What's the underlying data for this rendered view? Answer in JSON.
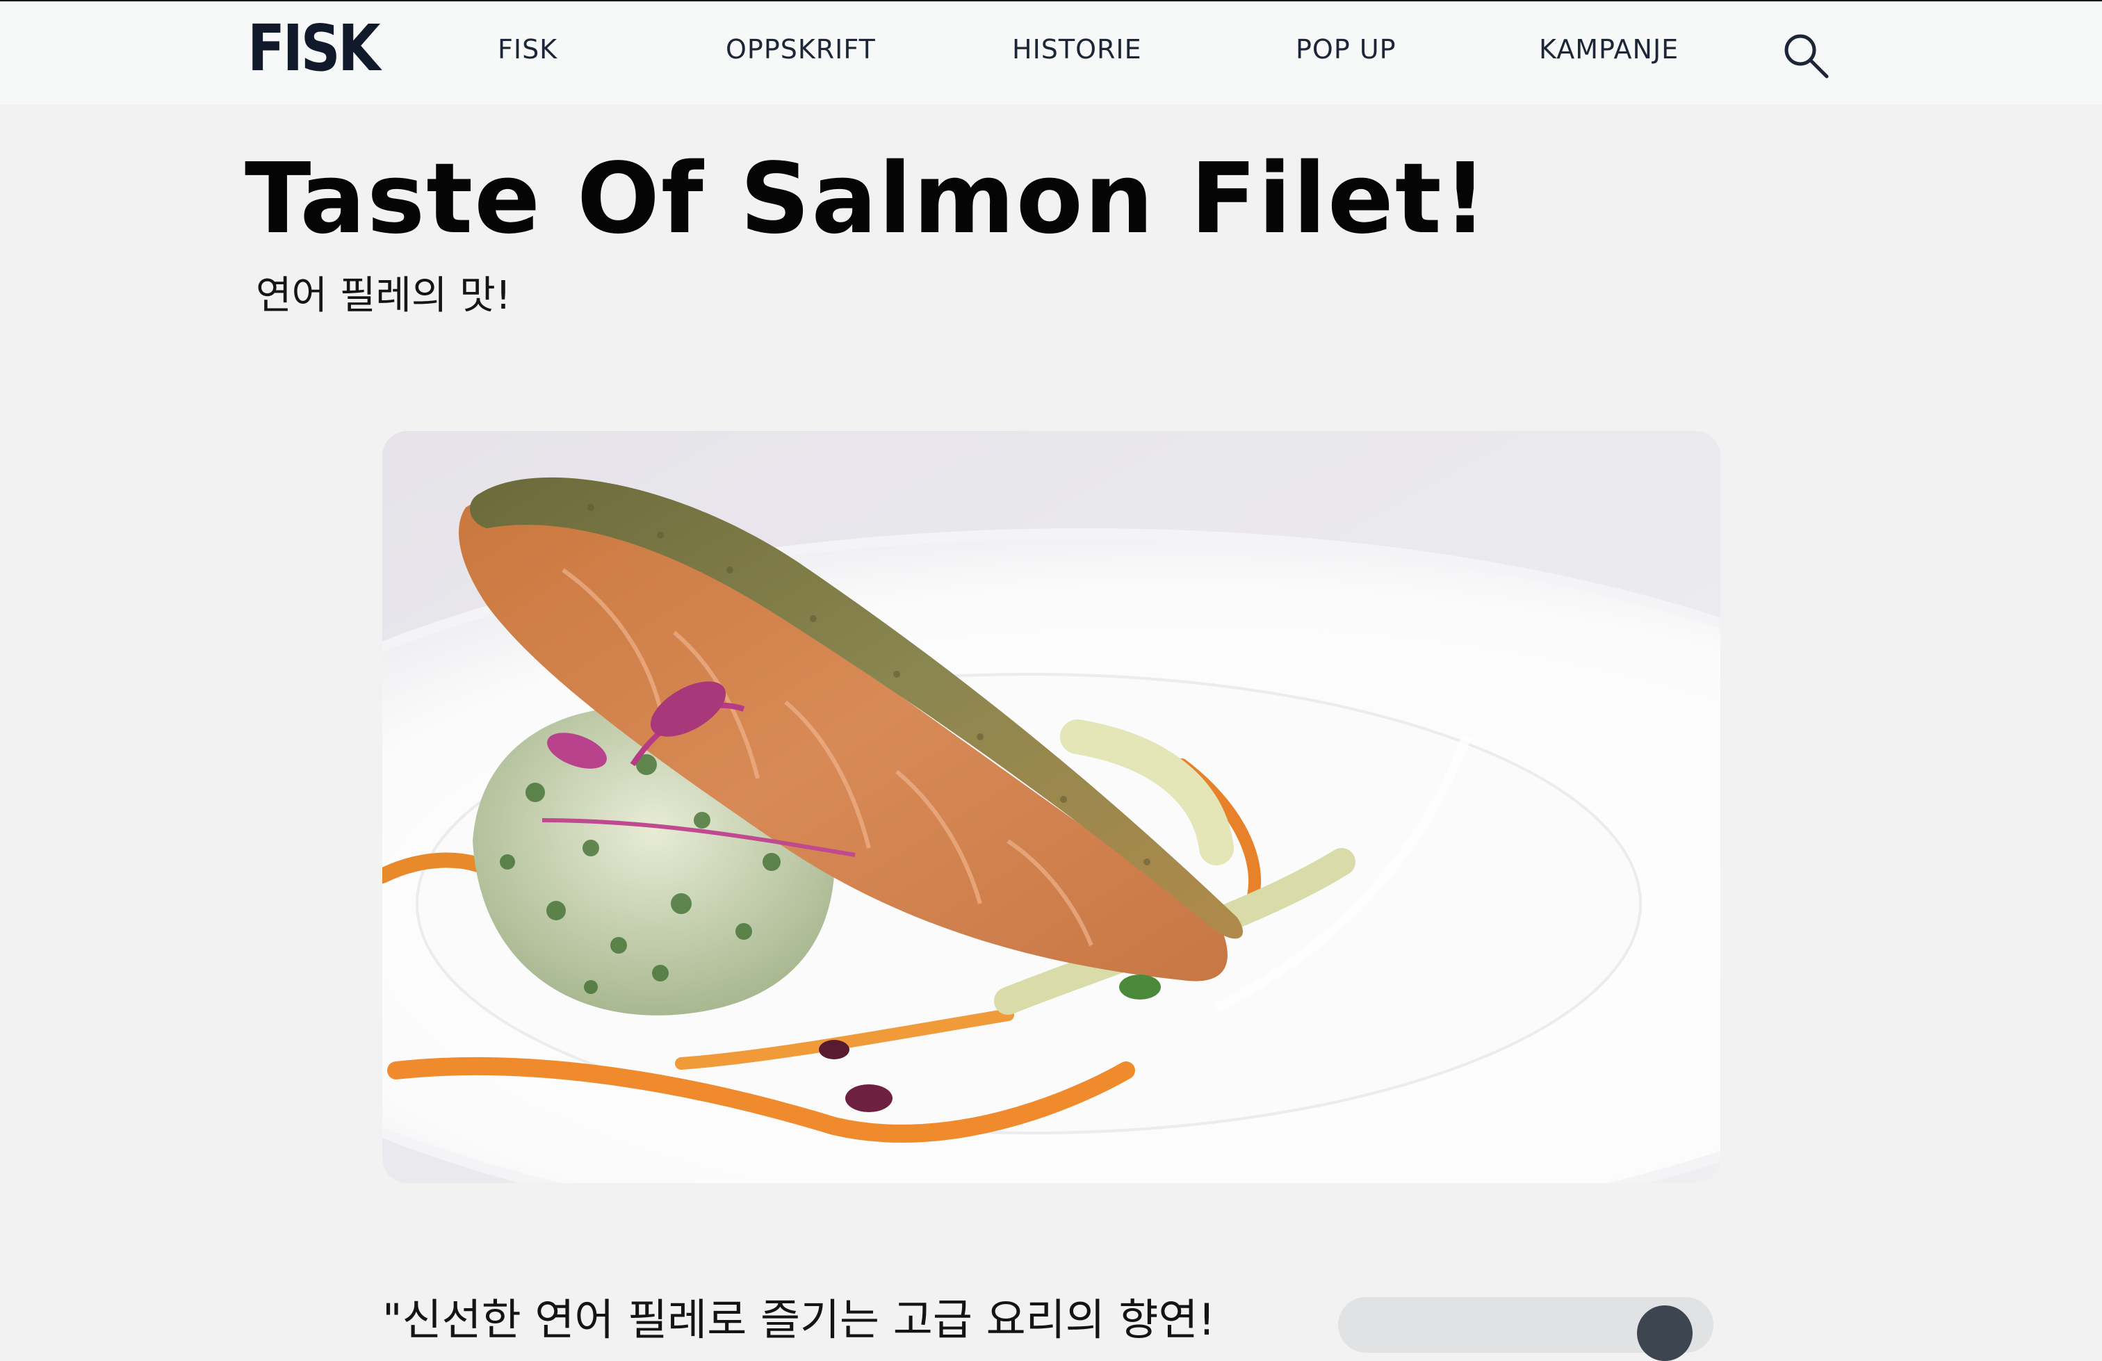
{
  "header": {
    "logo_text": "FISK",
    "nav": [
      {
        "label": "FISK"
      },
      {
        "label": "OPPSKRIFT"
      },
      {
        "label": "HISTORIE"
      },
      {
        "label": "POP UP"
      },
      {
        "label": "KAMPANJE"
      }
    ],
    "search_icon": "search-icon"
  },
  "main": {
    "title": "Taste Of Salmon Filet!",
    "subtitle": "연어 필레의 맛!",
    "hero_image": "grilled-salmon-filet-plate",
    "quote": "\"신선한 연어 필레로 즐기는 고급 요리의 향연!"
  },
  "colors": {
    "background": "#f1f2f1",
    "header_bg": "#f7f8f8",
    "logo": "#101a2a",
    "nav_text": "#1c2636"
  }
}
